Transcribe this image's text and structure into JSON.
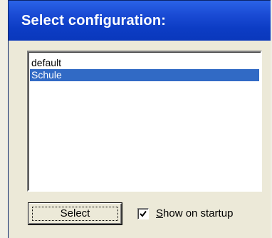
{
  "window": {
    "title": "Select configuration:"
  },
  "config_list": {
    "items": [
      {
        "label": "default",
        "selected": false
      },
      {
        "label": "Schule",
        "selected": true
      }
    ],
    "selected_color": "#316ac5"
  },
  "actions": {
    "select_label": "Select",
    "show_on_startup": {
      "mnemonic": "S",
      "label_rest": "how on startup",
      "checked": true
    }
  },
  "colors": {
    "title_bar": "#0c3cc4",
    "dialog_face": "#ece9d8"
  }
}
